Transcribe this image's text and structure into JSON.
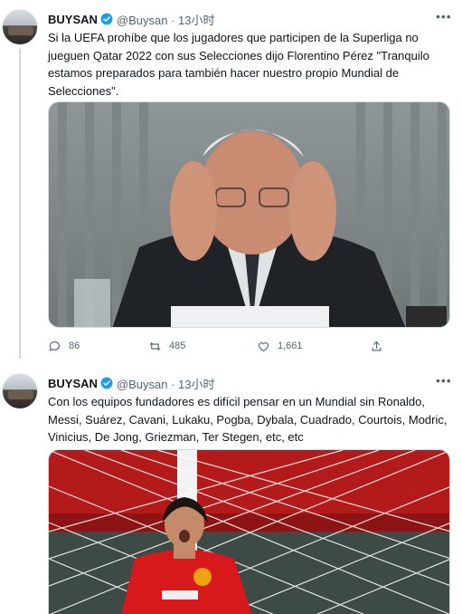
{
  "tweets": [
    {
      "name": "BUYSAN",
      "handle": "@Buysan · 13小时",
      "text": "Si la UEFA prohíbe que los jugadores que participen de la Superliga no jueguen Qatar 2022 con sus Selecciones dijo Florentino Pérez \"Tranquilo estamos preparados para también hacer nuestro propio Mundial de Selecciones\".",
      "media_icon": "photo-man-holding-head",
      "stats": {
        "replies": "86",
        "retweets": "485",
        "likes": "1,661"
      }
    },
    {
      "name": "BUYSAN",
      "handle": "@Buysan · 13小时",
      "text": "Con los equipos fundadores es difícil pensar en un Mundial sin Ronaldo, Messi, Suárez, Cavani, Lukaku, Pogba, Dybala, Cuadrado, Courtois, Modric, Vinicius, De Jong, Griezman, Ter Stegen, etc, etc",
      "media_icon": "photo-footballer-red-kit"
    }
  ],
  "colors": {
    "verified": "#1d9bf0",
    "secondary_text": "#536471",
    "border": "#cfd9de"
  }
}
